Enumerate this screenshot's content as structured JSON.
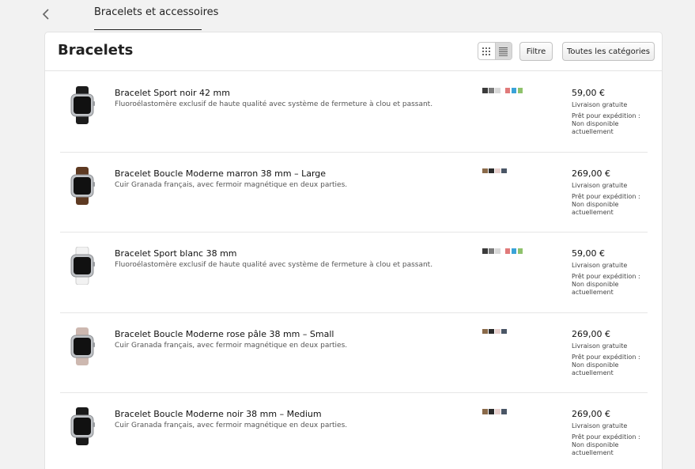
{
  "nav": {
    "tab_label": "Bracelets et accessoires"
  },
  "header": {
    "title": "Bracelets",
    "filter_label": "Filtre",
    "categories_label": "Toutes les catégories"
  },
  "products": [
    {
      "name": "Bracelet Sport noir 42 mm",
      "description": "Fluoroélastomère exclusif de haute qualité avec système de fermeture à clou et passant.",
      "price": "59,00 €",
      "delivery": "Livraison gratuite",
      "ship_status": [
        "Prêt pour expédition :",
        "Non disponible",
        "actuellement"
      ],
      "band_color": "#1c1c1c",
      "swatches": [
        "#3b3b3b",
        "#7a7a7a",
        "#d8d8d8",
        "#e07a7a",
        "#3aa3d8",
        "#8fc26c"
      ]
    },
    {
      "name": "Bracelet Boucle Moderne marron 38 mm – Large",
      "description": "Cuir Granada français, avec fermoir magnétique en deux parties.",
      "price": "269,00 €",
      "delivery": "Livraison gratuite",
      "ship_status": [
        "Prêt pour expédition :",
        "Non disponible",
        "actuellement"
      ],
      "band_color": "#5e3a22",
      "swatches": [
        "#8a6a4a",
        "#2b2b2b",
        "#e6cfcc",
        "#4a5666"
      ]
    },
    {
      "name": "Bracelet Sport blanc 38 mm",
      "description": "Fluoroélastomère exclusif de haute qualité avec système de fermeture à clou et passant.",
      "price": "59,00 €",
      "delivery": "Livraison gratuite",
      "ship_status": [
        "Prêt pour expédition :",
        "Non disponible",
        "actuellement"
      ],
      "band_color": "#f2f2f2",
      "swatches": [
        "#3b3b3b",
        "#7a7a7a",
        "#d8d8d8",
        "#e07a7a",
        "#3aa3d8",
        "#8fc26c"
      ]
    },
    {
      "name": "Bracelet Boucle Moderne rose pâle 38 mm – Small",
      "description": "Cuir Granada français, avec fermoir magnétique en deux parties.",
      "price": "269,00 €",
      "delivery": "Livraison gratuite",
      "ship_status": [
        "Prêt pour expédition :",
        "Non disponible",
        "actuellement"
      ],
      "band_color": "#cdb8b0",
      "swatches": [
        "#8a6a4a",
        "#2b2b2b",
        "#e6cfcc",
        "#4a5666"
      ]
    },
    {
      "name": "Bracelet Boucle Moderne noir 38 mm – Medium",
      "description": "Cuir Granada français, avec fermoir magnétique en deux parties.",
      "price": "269,00 €",
      "delivery": "Livraison gratuite",
      "ship_status": [
        "Prêt pour expédition :",
        "Non disponible",
        "actuellement"
      ],
      "band_color": "#1a1a1a",
      "swatches": [
        "#8a6a4a",
        "#2b2b2b",
        "#e6cfcc",
        "#4a5666"
      ]
    }
  ],
  "icons": {
    "back": "chevron-left-icon",
    "grid": "grid-view-icon",
    "list": "list-view-icon"
  }
}
